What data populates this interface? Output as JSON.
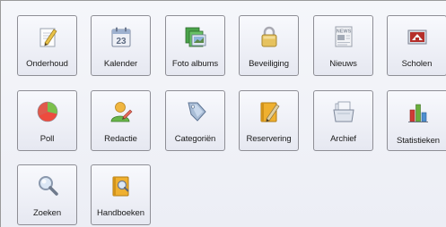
{
  "tiles": [
    {
      "label": "Onderhoud",
      "icon": "document-pencil-icon"
    },
    {
      "label": "Kalender",
      "icon": "calendar-icon",
      "day": "23"
    },
    {
      "label": "Foto albums",
      "icon": "photo-albums-icon"
    },
    {
      "label": "Beveiliging",
      "icon": "padlock-icon"
    },
    {
      "label": "Nieuws",
      "icon": "newspaper-icon",
      "badge": "NEWS"
    },
    {
      "label": "Scholen",
      "icon": "school-icon"
    },
    {
      "label": "Poll",
      "icon": "pie-chart-icon"
    },
    {
      "label": "Redactie",
      "icon": "user-pencil-icon"
    },
    {
      "label": "Categoriën",
      "icon": "tag-icon"
    },
    {
      "label": "Reservering",
      "icon": "notebook-pencil-icon"
    },
    {
      "label": "Archief",
      "icon": "archive-documents-icon"
    },
    {
      "label": "Statistieken",
      "icon": "bar-chart-icon"
    },
    {
      "label": "Zoeken",
      "icon": "magnifier-icon"
    },
    {
      "label": "Handboeken",
      "icon": "handbook-icon"
    }
  ],
  "colors": {
    "tile_border": "#8e8e95",
    "panel_background": "#f0f1f6"
  }
}
